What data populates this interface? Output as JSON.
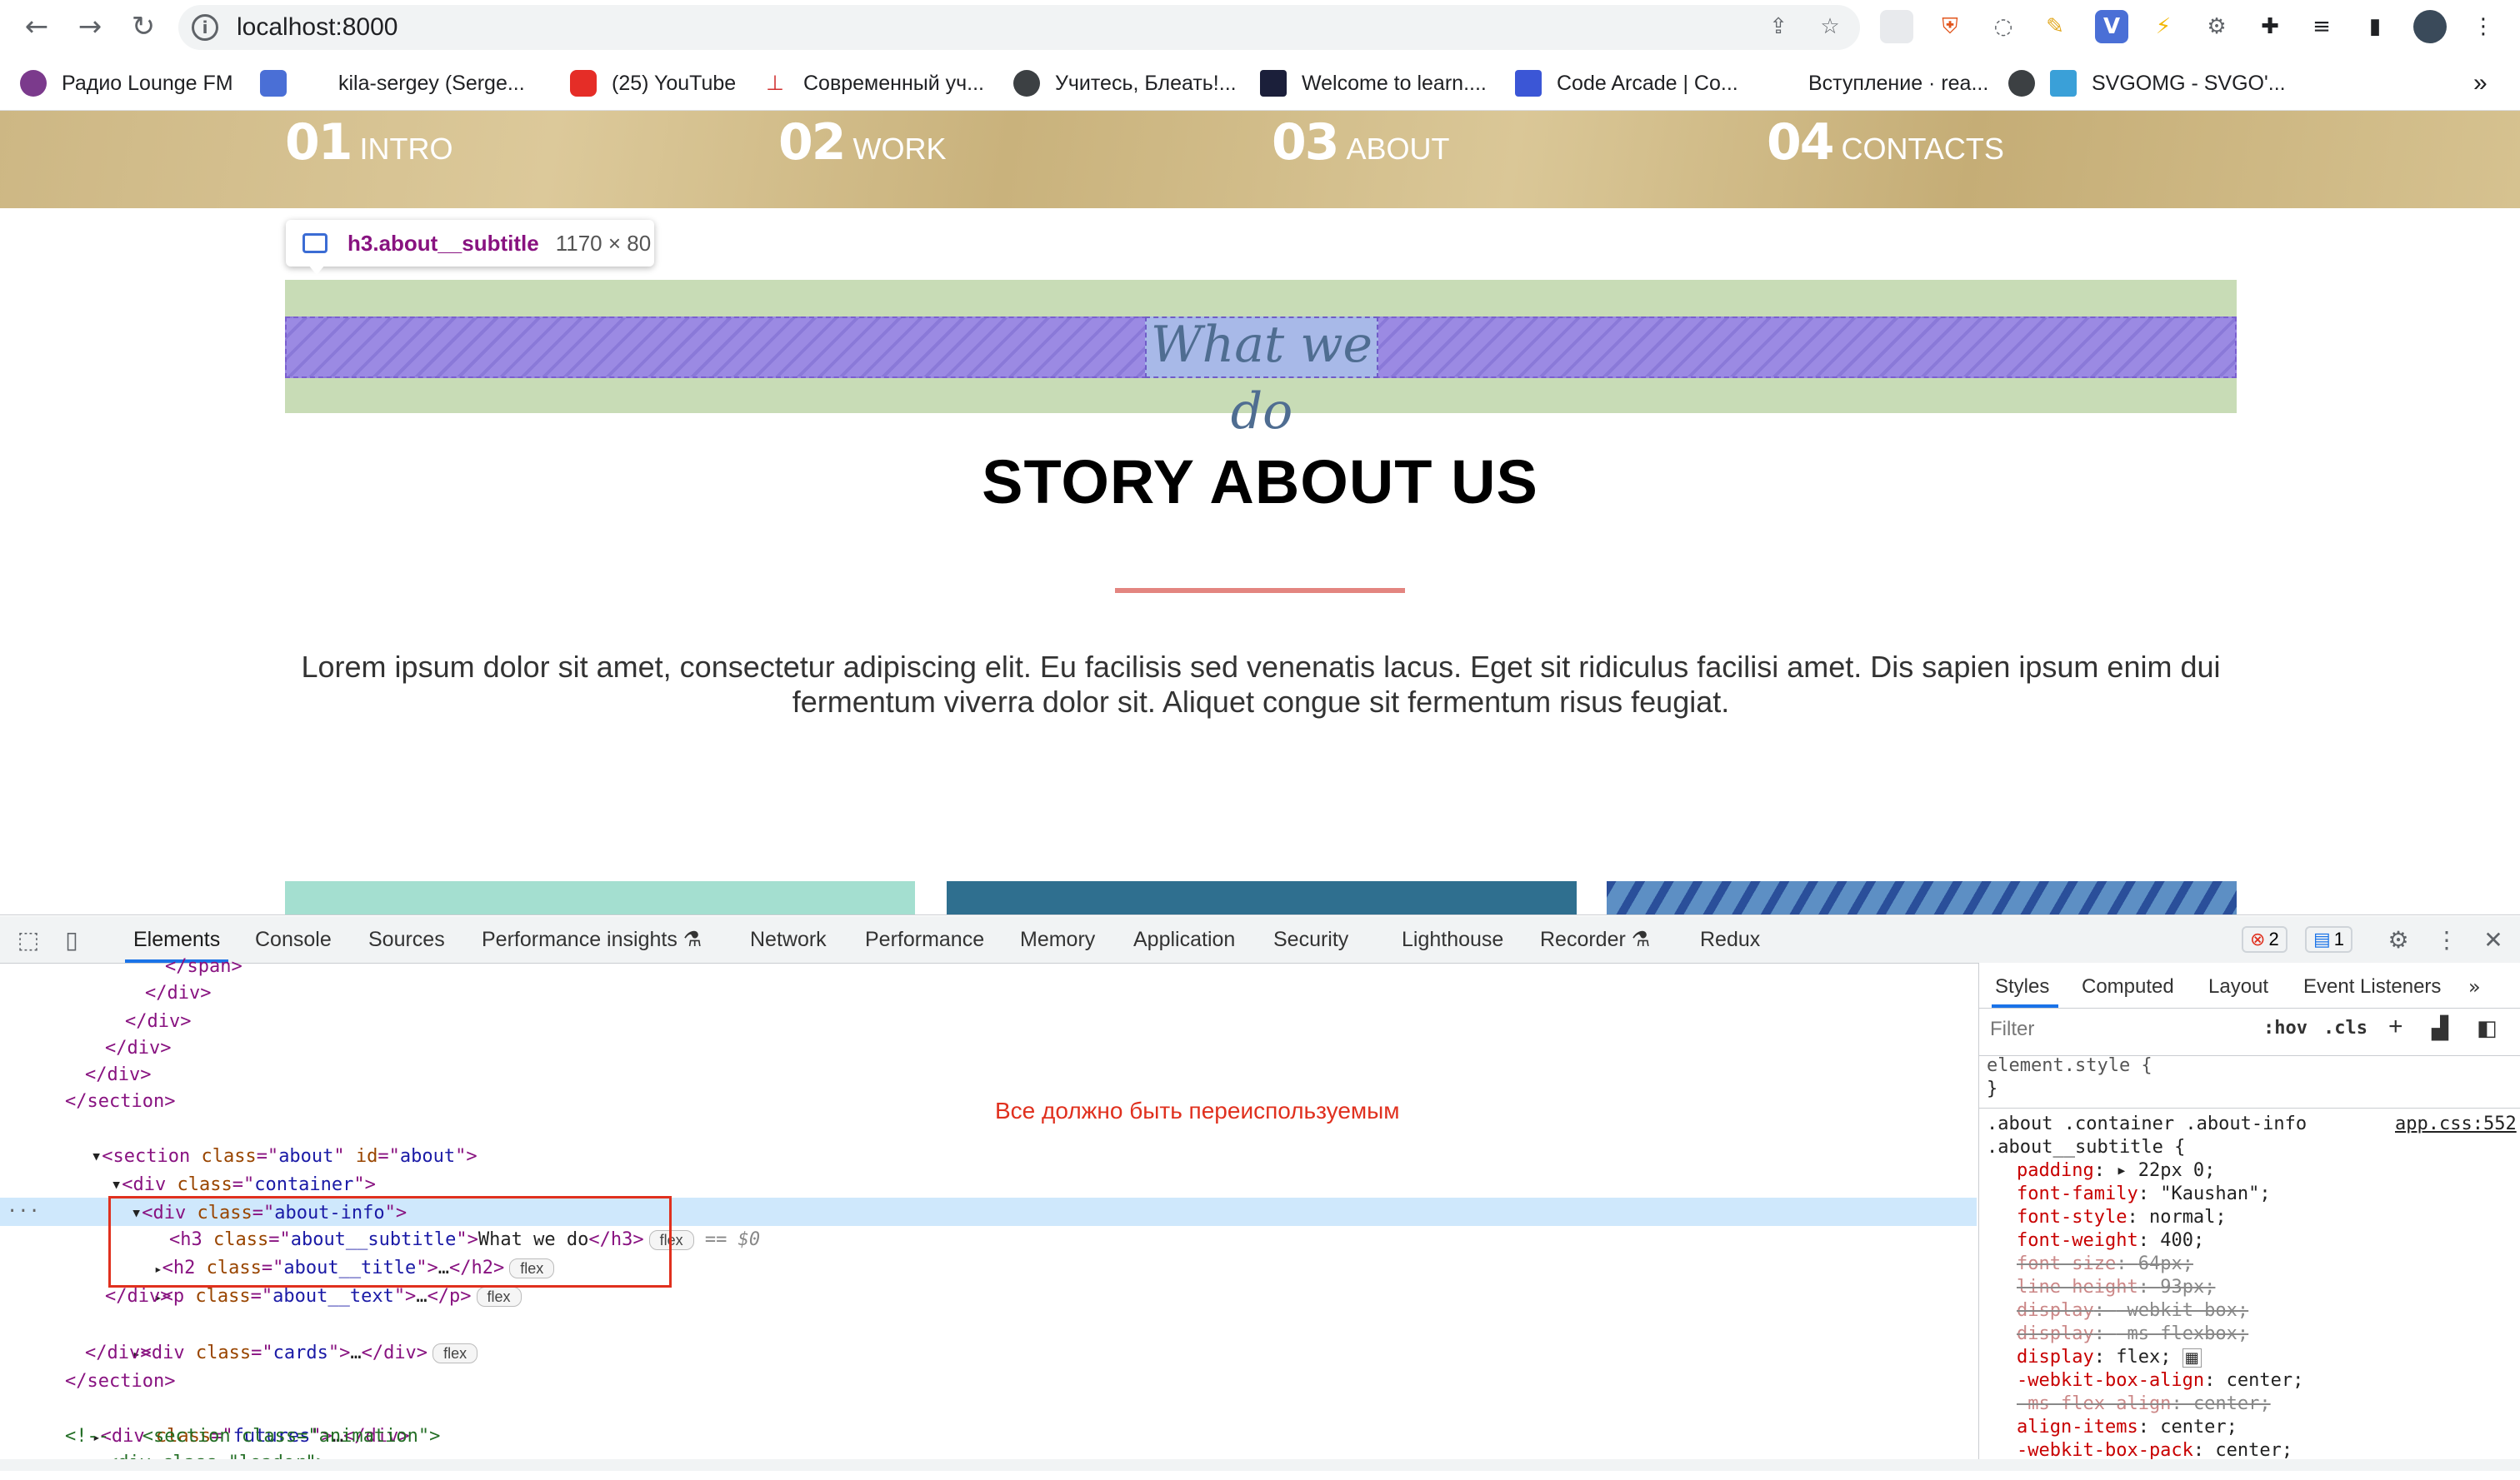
{
  "browser": {
    "url": "localhost:8000",
    "bookmarks": [
      "Радио Lounge FM",
      "kila-sergey (Serge...",
      "(25) YouTube",
      "Современный уч...",
      "Учитесь, Блеать!...",
      "Welcome to learn....",
      "Code Arcade | Co...",
      "Вступление · rea...",
      "SVGOMG - SVGO'..."
    ],
    "more_bookmarks": "»"
  },
  "page": {
    "nav": [
      {
        "num": "01",
        "label": "INTRO"
      },
      {
        "num": "02",
        "label": "WORK"
      },
      {
        "num": "03",
        "label": "ABOUT"
      },
      {
        "num": "04",
        "label": "CONTACTS"
      }
    ],
    "inspect_tooltip": {
      "selector": "h3.about__subtitle",
      "size": "1170 × 80"
    },
    "subtitle": "What we do",
    "title": "STORY ABOUT US",
    "text": "Lorem ipsum dolor sit amet, consectetur adipiscing elit. Eu facilisis sed venenatis lacus. Eget sit ridiculus facilisi amet. Dis sapien ipsum enim dui fermentum viverra dolor sit. Aliquet congue sit fermentum risus feugiat.",
    "card_colors": [
      "#a4dfd0",
      "#2f6f8f",
      "#5d8fc4"
    ]
  },
  "devtools": {
    "tabs": [
      "Elements",
      "Console",
      "Sources",
      "Performance insights",
      "Network",
      "Performance",
      "Memory",
      "Application",
      "Security",
      "Lighthouse",
      "Recorder",
      "Redux"
    ],
    "errors": "2",
    "messages": "1",
    "dom_lines": [
      "</span>",
      "</div>",
      "</div>",
      "</div>",
      "</div>",
      "</section>"
    ],
    "dom_section": {
      "tag": "section",
      "class": "about",
      "id": "about"
    },
    "dom_container": "container",
    "dom_about_info": "about-info",
    "dom_h3": {
      "class": "about__subtitle",
      "text": "What we do",
      "badge": "flex",
      "marker": "== $0"
    },
    "dom_h2": {
      "class": "about__title",
      "badge": "flex"
    },
    "dom_p": {
      "class": "about__text",
      "badge": "flex"
    },
    "dom_cards": {
      "class": "cards",
      "badge": "flex"
    },
    "dom_futures": "futures",
    "dom_comment": "<!--   <section class=\"animation\">",
    "dom_loader": "<div class=\"loader\">",
    "note": "Все должно быть переиспользуемым",
    "styles_tabs": [
      "Styles",
      "Computed",
      "Layout",
      "Event Listeners"
    ],
    "filter_placeholder": "Filter",
    "hov": ":hov",
    "cls": ".cls",
    "element_style": "element.style {",
    "rule_selector_1": ".about .container .about-info",
    "rule_selector_2": ".about__subtitle {",
    "rule_source": "app.css:552",
    "rules": [
      {
        "prop": "padding",
        "value": "▸ 22px 0;",
        "strike": false
      },
      {
        "prop": "font-family",
        "value": "\"Kaushan\";",
        "strike": false
      },
      {
        "prop": "font-style",
        "value": "normal;",
        "strike": false
      },
      {
        "prop": "font-weight",
        "value": "400;",
        "strike": false
      },
      {
        "prop": "font-size",
        "value": "64px;",
        "strike": true
      },
      {
        "prop": "line-height",
        "value": "93px;",
        "strike": true
      },
      {
        "prop": "display",
        "value": "-webkit-box;",
        "strike": true
      },
      {
        "prop": "display",
        "value": "-ms-flexbox;",
        "strike": true
      },
      {
        "prop": "display",
        "value": "flex;",
        "strike": false
      },
      {
        "prop": "-webkit-box-align",
        "value": "center;",
        "strike": false
      },
      {
        "prop": "-ms-flex-align",
        "value": "center;",
        "strike": true
      },
      {
        "prop": "align-items",
        "value": "center;",
        "strike": false
      },
      {
        "prop": "-webkit-box-pack",
        "value": "center;",
        "strike": false
      }
    ]
  }
}
